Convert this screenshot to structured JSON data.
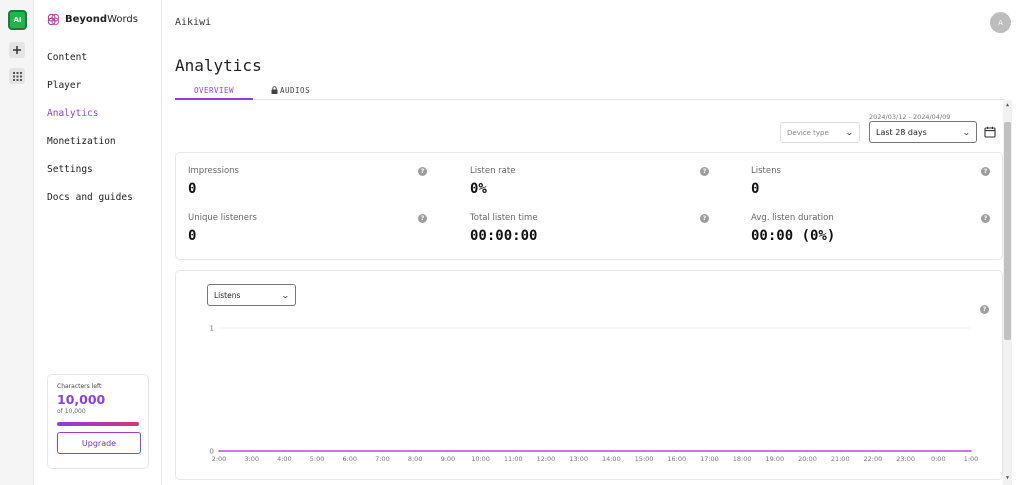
{
  "workspace": {
    "badge": "AI",
    "add_icon": "plus-icon",
    "apps_icon": "grid-icon"
  },
  "brand": {
    "name_bold": "Beyond",
    "name_rest": "Words"
  },
  "sidebar": {
    "items": [
      {
        "label": "Content"
      },
      {
        "label": "Player"
      },
      {
        "label": "Analytics",
        "active": true
      },
      {
        "label": "Monetization"
      },
      {
        "label": "Settings"
      },
      {
        "label": "Docs and guides"
      }
    ],
    "characters": {
      "label": "Characters left",
      "value": "10,000",
      "of": "of 10,000",
      "progress": 1.0,
      "upgrade_label": "Upgrade"
    }
  },
  "header": {
    "org_name": "Aikiwi",
    "avatar_initial": "A"
  },
  "page": {
    "title": "Analytics"
  },
  "tabs": [
    {
      "label": "OVERVIEW",
      "active": true
    },
    {
      "label": "AUDIOS",
      "icon": "lock-icon"
    }
  ],
  "filters": {
    "device_placeholder": "Device type",
    "date_range": "2024/03/12 - 2024/04/09",
    "period": "Last 28 days",
    "calendar_icon": "calendar-icon"
  },
  "stats": [
    {
      "label": "Impressions",
      "value": "0"
    },
    {
      "label": "Listen rate",
      "value": "0%"
    },
    {
      "label": "Listens",
      "value": "0"
    },
    {
      "label": "Unique listeners",
      "value": "0"
    },
    {
      "label": "Total listen time",
      "value": "00:00:00"
    },
    {
      "label": "Avg. listen duration",
      "value": "00:00 (0%)"
    }
  ],
  "chart": {
    "metric": "Listens",
    "help": "?"
  },
  "colors": {
    "accent": "#8b3fe0",
    "line": "#b44fd8"
  },
  "chart_data": {
    "type": "line",
    "x": [
      "2:00",
      "3:00",
      "4:00",
      "5:00",
      "6:00",
      "7:00",
      "8:00",
      "9:00",
      "10:00",
      "11:00",
      "12:00",
      "13:00",
      "14:00",
      "15:00",
      "16:00",
      "17:00",
      "18:00",
      "19:00",
      "20:00",
      "21:00",
      "22:00",
      "23:00",
      "0:00",
      "1:00"
    ],
    "series": [
      {
        "values": [
          0,
          0,
          0,
          0,
          0,
          0,
          0,
          0,
          0,
          0,
          0,
          0,
          0,
          0,
          0,
          0,
          0,
          0,
          0,
          0,
          0,
          0,
          0,
          0
        ]
      }
    ],
    "ylim": [
      0,
      1
    ],
    "yticks": [
      0,
      1
    ],
    "grid": true
  }
}
